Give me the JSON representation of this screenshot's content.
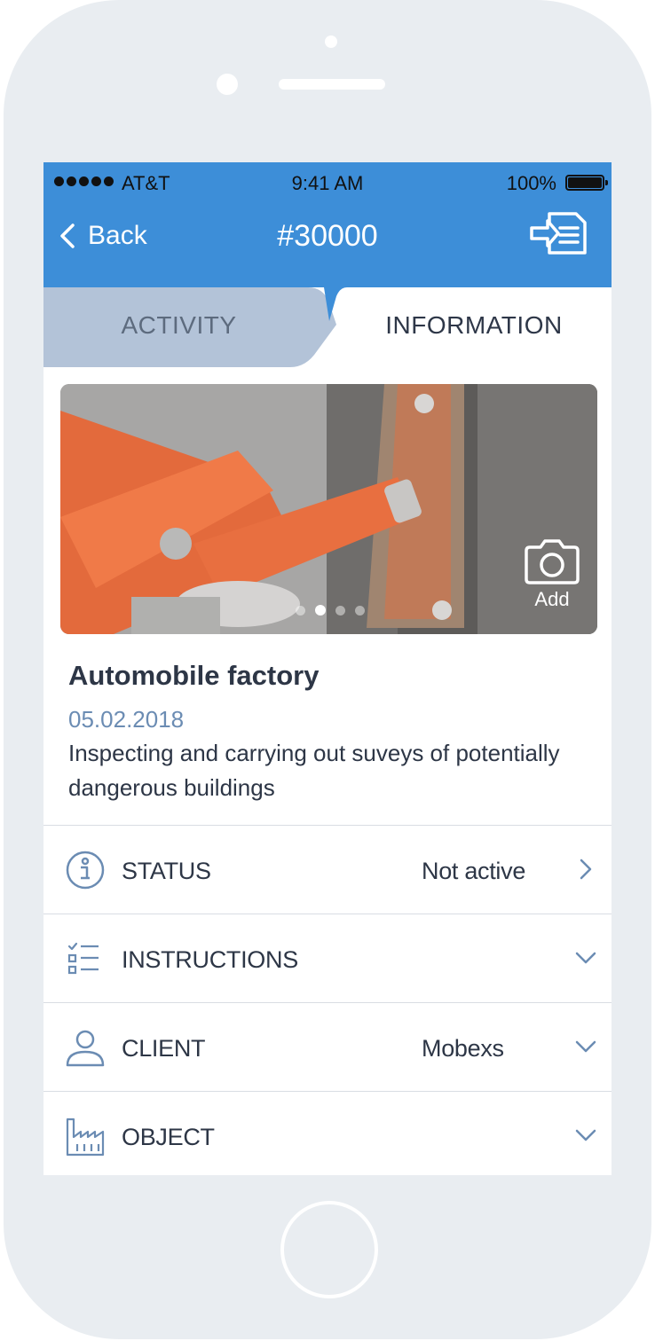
{
  "status_bar": {
    "carrier": "AT&T",
    "time": "9:41 AM",
    "battery": "100%"
  },
  "nav": {
    "back_label": "Back",
    "title": "#30000",
    "export_icon": "export-list-icon"
  },
  "tabs": [
    {
      "label": "ACTIVITY",
      "active": false
    },
    {
      "label": "INFORMATION",
      "active": true
    }
  ],
  "gallery": {
    "add_label": "Add",
    "page_count": 4,
    "current_page": 2
  },
  "job": {
    "title": "Automobile factory",
    "date": "05.02.2018",
    "description": "Inspecting and carrying out suveys of potentially dangerous buildings"
  },
  "rows": [
    {
      "icon": "info-icon",
      "label": "STATUS",
      "value": "Not active",
      "action": "chevron-right-icon"
    },
    {
      "icon": "checklist-icon",
      "label": "INSTRUCTIONS",
      "value": "",
      "action": "chevron-down-icon"
    },
    {
      "icon": "person-icon",
      "label": "CLIENT",
      "value": "Mobexs",
      "action": "chevron-down-icon"
    },
    {
      "icon": "factory-icon",
      "label": "OBJECT",
      "value": "",
      "action": "chevron-down-icon"
    }
  ],
  "colors": {
    "primary": "#3d8ed8",
    "inactive_tab": "#b3c3d8",
    "text_dark": "#2d3646",
    "date": "#6b8cb3",
    "icon": "#6b8cb3"
  }
}
